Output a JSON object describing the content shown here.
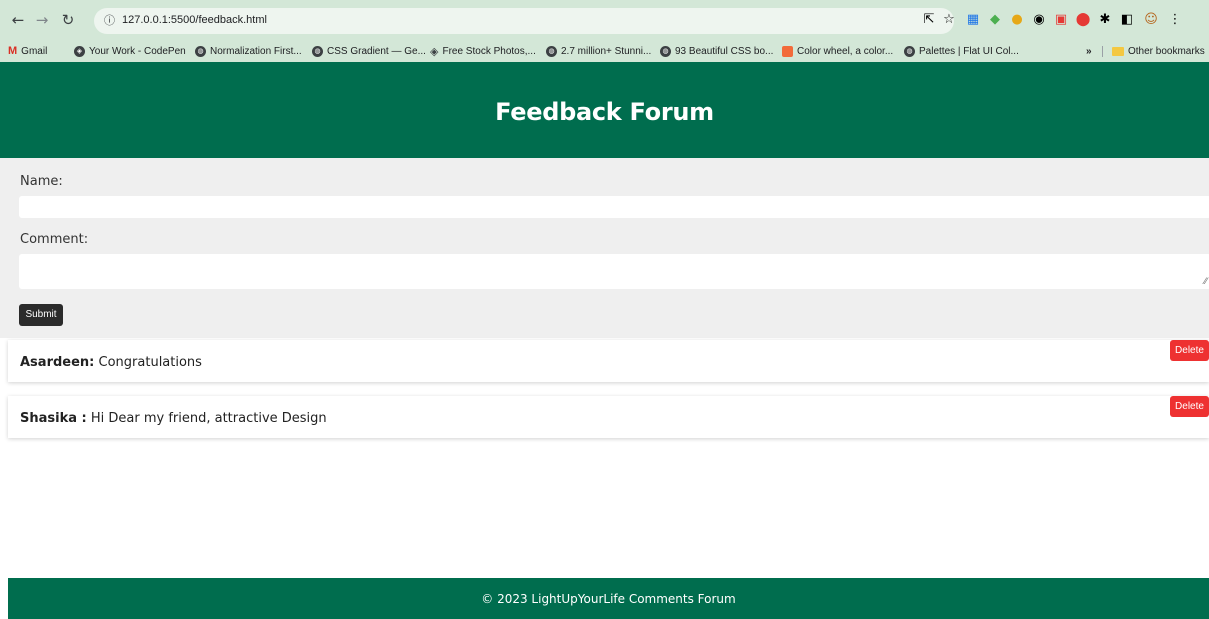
{
  "browser": {
    "url": "127.0.0.1:5500/feedback.html",
    "bookmarks": [
      {
        "label": "Gmail",
        "icon": "gmail-icon"
      },
      {
        "label": "Your Work - CodePen",
        "icon": "codepen-icon"
      },
      {
        "label": "Normalization First...",
        "icon": "globe-icon"
      },
      {
        "label": "CSS Gradient — Ge...",
        "icon": "globe-icon"
      },
      {
        "label": "Free Stock Photos,...",
        "icon": "pexels-icon"
      },
      {
        "label": "2.7 million+ Stunni...",
        "icon": "globe-icon"
      },
      {
        "label": "93 Beautiful CSS bo...",
        "icon": "globe-icon"
      },
      {
        "label": "Color wheel, a color...",
        "icon": "adobe-color-icon"
      },
      {
        "label": "Palettes | Flat UI Col...",
        "icon": "globe-icon"
      }
    ],
    "overflow": "»",
    "other_bookmarks": "Other bookmarks"
  },
  "header": {
    "title": "Feedback Forum"
  },
  "form": {
    "name_label": "Name:",
    "name_value": "",
    "comment_label": "Comment:",
    "comment_value": "",
    "submit_label": "Submit"
  },
  "comments": [
    {
      "author": "Asardeen:",
      "text": " Congratulations",
      "delete_label": "Delete"
    },
    {
      "author": "Shasika :",
      "text": " Hi Dear my friend, attractive Design",
      "delete_label": "Delete"
    }
  ],
  "footer": {
    "text": "© 2023 LightUpYourLife Comments Forum"
  },
  "colors": {
    "brand": "#006d4e",
    "delete": "#ee3131",
    "submit": "#2b2b2b",
    "form_bg": "#efefef"
  }
}
